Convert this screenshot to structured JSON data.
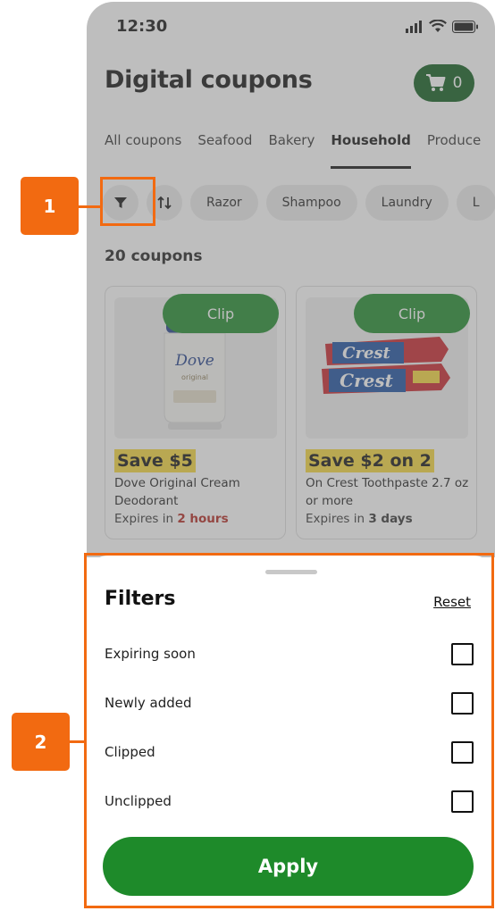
{
  "status_bar": {
    "time": "12:30"
  },
  "header": {
    "title": "Digital coupons",
    "cart_count": "0"
  },
  "tabs": [
    {
      "label": "All coupons"
    },
    {
      "label": "Seafood"
    },
    {
      "label": "Bakery"
    },
    {
      "label": "Household",
      "active": true
    },
    {
      "label": "Produce"
    }
  ],
  "chips": [
    {
      "label": "Razor"
    },
    {
      "label": "Shampoo"
    },
    {
      "label": "Laundry"
    },
    {
      "label": "L"
    }
  ],
  "results": {
    "count_label": "20 coupons"
  },
  "coupons": [
    {
      "clip_label": "Clip",
      "save": "Save $5",
      "name": "Dove Original Cream Deodorant",
      "expires_prefix": "Expires in",
      "expires_value": "2 hours",
      "urgent": true
    },
    {
      "clip_label": "Clip",
      "save": "Save $2 on 2",
      "name": "On Crest Toothpaste 2.7 oz or more",
      "expires_prefix": "Expires in",
      "expires_value": "3 days",
      "urgent": false
    }
  ],
  "filters_sheet": {
    "title": "Filters",
    "reset_label": "Reset",
    "options": [
      {
        "label": "Expiring soon",
        "checked": false
      },
      {
        "label": "Newly added",
        "checked": false
      },
      {
        "label": "Clipped",
        "checked": false
      },
      {
        "label": "Unclipped",
        "checked": false
      }
    ],
    "apply_label": "Apply"
  },
  "annotations": {
    "callout_1": "1",
    "callout_2": "2"
  },
  "colors": {
    "primary_green": "#1e8a2a",
    "dark_green": "#0d5c1c",
    "highlight_orange": "#f26a11",
    "save_yellow": "#f6d83b",
    "urgent_red": "#b3261e"
  }
}
